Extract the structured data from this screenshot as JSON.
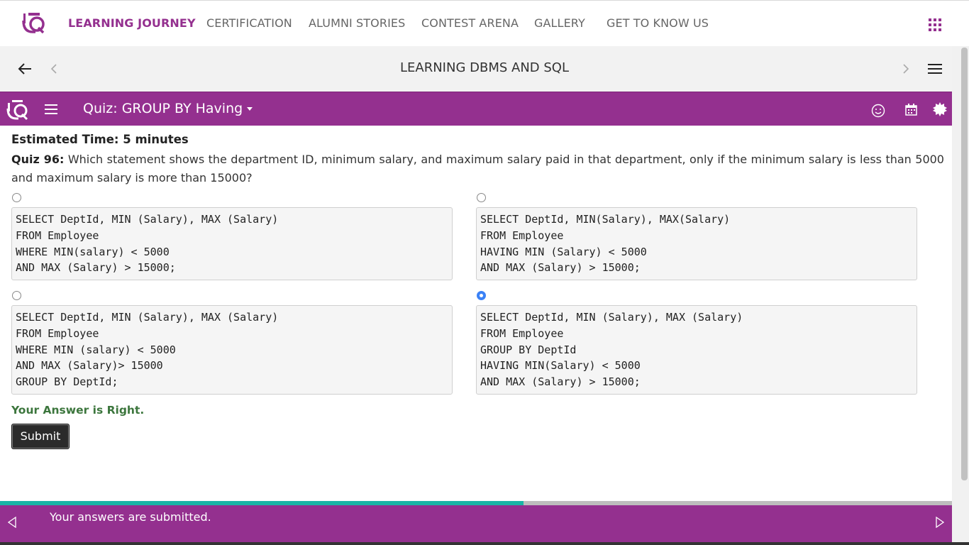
{
  "nav": {
    "items": [
      {
        "label": "LEARNING JOURNEY",
        "active": true
      },
      {
        "label": "CERTIFICATION",
        "active": false
      },
      {
        "label": "ALUMNI STORIES",
        "active": false
      },
      {
        "label": "CONTEST ARENA",
        "active": false
      },
      {
        "label": "GALLERY",
        "active": false
      },
      {
        "label": "GET TO KNOW US",
        "active": false
      }
    ],
    "logo_icon": "infytq-logo",
    "apps_icon": "grid-apps-icon"
  },
  "course": {
    "title": "LEARNING DBMS AND SQL"
  },
  "quiz_bar": {
    "title": "Quiz: GROUP BY Having"
  },
  "content": {
    "estimated_time": "Estimated Time: 5 minutes",
    "question_label": "Quiz 96:",
    "question_text": "Which statement shows the department ID, minimum salary, and maximum salary paid in that department, only if the minimum salary is less than 5000 and maximum salary is more than 15000?",
    "options": [
      {
        "selected": false,
        "lines": [
          "SELECT DeptId, MIN (Salary), MAX (Salary)",
          "FROM Employee",
          "WHERE MIN(salary) < 5000",
          "AND MAX (Salary) > 15000;"
        ]
      },
      {
        "selected": false,
        "lines": [
          "SELECT DeptId, MIN(Salary), MAX(Salary)",
          "FROM Employee",
          "HAVING MIN (Salary) < 5000",
          "AND MAX (Salary) > 15000;"
        ]
      },
      {
        "selected": false,
        "lines": [
          "SELECT DeptId, MIN (Salary), MAX (Salary)",
          "FROM Employee",
          "WHERE MIN (salary) < 5000",
          "AND MAX (Salary)> 15000",
          "GROUP BY DeptId;"
        ]
      },
      {
        "selected": true,
        "lines": [
          "SELECT DeptId, MIN (Salary), MAX (Salary)",
          "FROM Employee",
          "GROUP BY DeptId",
          "HAVING MIN(Salary) < 5000",
          "AND MAX (Salary) > 15000;"
        ]
      }
    ],
    "result": "Your Answer is Right.",
    "submit_label": "Submit"
  },
  "footer": {
    "message": "Your answers are submitted.",
    "progress_fraction": 0.55
  },
  "colors": {
    "brand_purple": "#94308f",
    "progress_teal": "#1ab5a6",
    "success_green": "#3c763d"
  }
}
